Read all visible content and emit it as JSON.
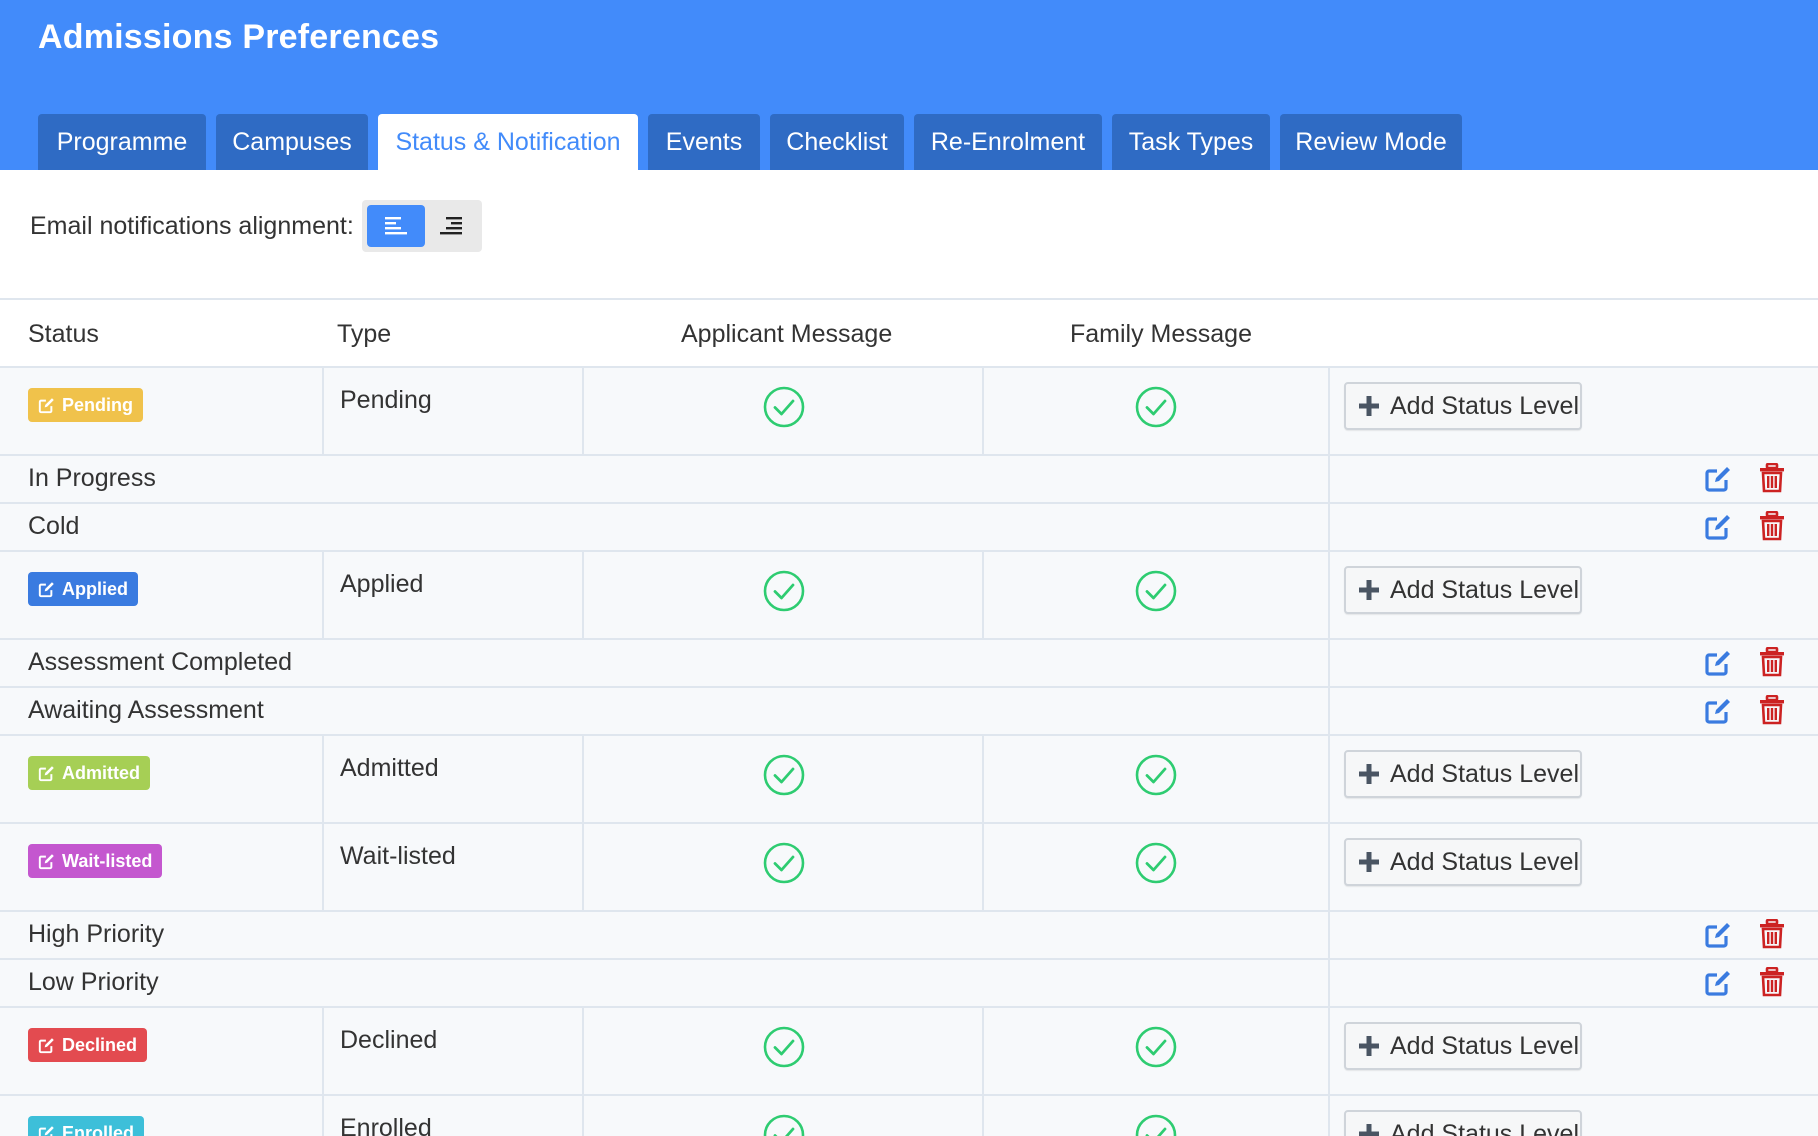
{
  "header": {
    "title": "Admissions Preferences",
    "tabs": [
      {
        "label": "Programme"
      },
      {
        "label": "Campuses"
      },
      {
        "label": "Status & Notification"
      },
      {
        "label": "Events"
      },
      {
        "label": "Checklist"
      },
      {
        "label": "Re-Enrolment"
      },
      {
        "label": "Task Types"
      },
      {
        "label": "Review Mode"
      }
    ],
    "active_tab": "Status & Notification"
  },
  "email_alignment": {
    "label": "Email notifications alignment:",
    "options": [
      "align-left-icon",
      "align-right-icon"
    ],
    "selected": "left"
  },
  "table": {
    "headers": {
      "status": "Status",
      "type": "Type",
      "applicant": "Applicant Message",
      "family": "Family Message"
    },
    "add_level_label": "Add Status Level",
    "statuses": [
      {
        "badge": "Pending",
        "type": "Pending",
        "color": "#f0c24b",
        "applicant_message": true,
        "family_message": true
      },
      {
        "level": "In Progress"
      },
      {
        "level": "Cold"
      },
      {
        "badge": "Applied",
        "type": "Applied",
        "color": "#3a7be0",
        "applicant_message": true,
        "family_message": true
      },
      {
        "level": "Assessment Completed"
      },
      {
        "level": "Awaiting Assessment"
      },
      {
        "badge": "Admitted",
        "type": "Admitted",
        "color": "#a6cf55",
        "applicant_message": true,
        "family_message": true
      },
      {
        "badge": "Wait-listed",
        "type": "Wait-listed",
        "color": "#c457cf",
        "applicant_message": true,
        "family_message": true
      },
      {
        "level": "High Priority"
      },
      {
        "level": "Low Priority"
      },
      {
        "badge": "Declined",
        "type": "Declined",
        "color": "#e34b50",
        "applicant_message": true,
        "family_message": true
      },
      {
        "badge": "Enrolled",
        "type": "Enrolled",
        "color": "#3dbfd9",
        "applicant_message": true,
        "family_message": true
      }
    ]
  },
  "colors": {
    "accent": "#428bfa",
    "tab_inactive": "#2f6bc4",
    "check_green": "#2ecc71",
    "edit_blue": "#3a7be0",
    "delete_red": "#cc2222"
  }
}
